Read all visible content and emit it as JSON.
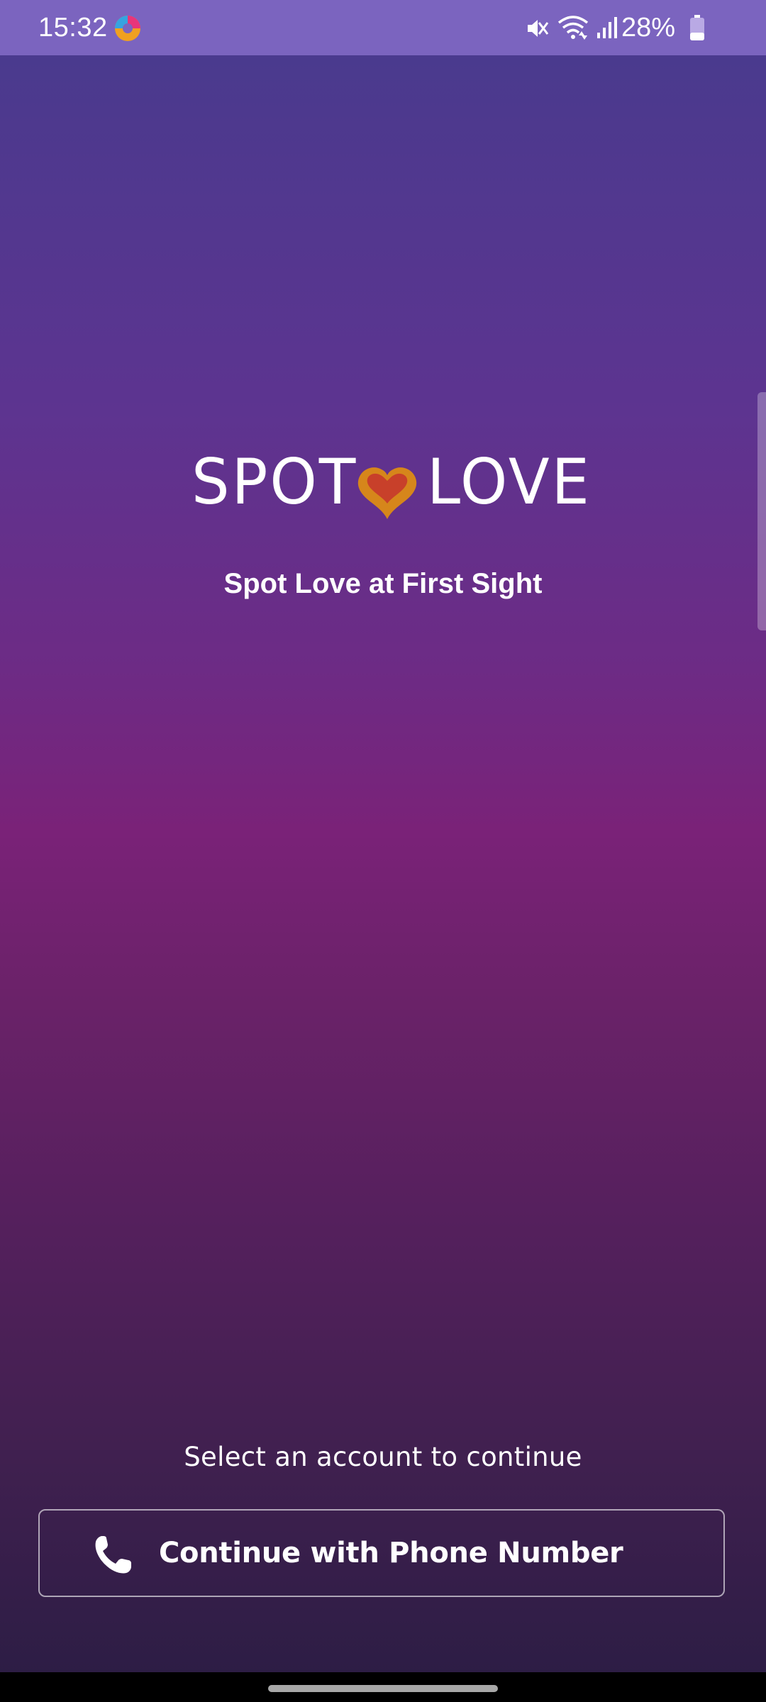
{
  "status_bar": {
    "time": "15:32",
    "battery": "28%",
    "icons": [
      "app-notification-icon",
      "mute-icon",
      "wifi-icon",
      "signal-icon",
      "battery-icon"
    ]
  },
  "logo": {
    "left_word": "SPOT",
    "right_word": "LOVE",
    "heart_outer_color": "#d6861b",
    "heart_inner_color": "#c8402a"
  },
  "tagline": "Spot Love at First Sight",
  "account": {
    "prompt": "Select an account to continue",
    "phone_button_label": "Continue with Phone Number",
    "phone_button_icon": "phone-icon"
  },
  "colors": {
    "status_bar": "#7b64bf",
    "gradient_top": "#4a3a8e",
    "gradient_mid": "#7a2278",
    "gradient_bottom": "#2d1d45"
  }
}
